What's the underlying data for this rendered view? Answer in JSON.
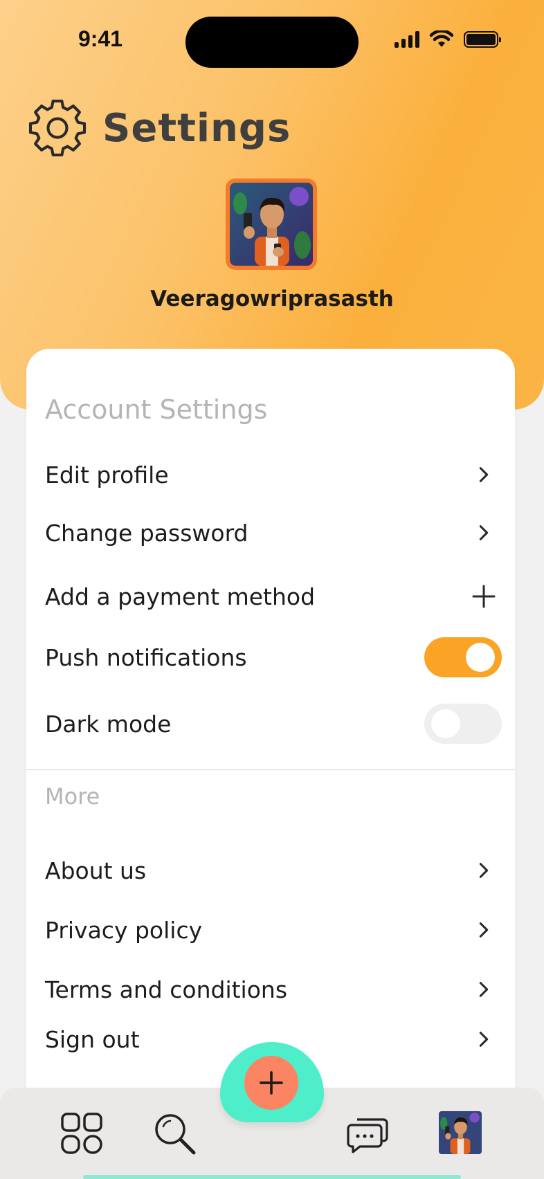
{
  "status_bar": {
    "time": "9:41"
  },
  "header": {
    "title": "Settings",
    "title_icon": "gear-icon",
    "user_name": "Veeragowriprasasth",
    "accent_color": "#fbb03d"
  },
  "account_settings": {
    "section_title": "Account Settings",
    "items": [
      {
        "label": "Edit profile",
        "control": "chevron-right-icon"
      },
      {
        "label": "Change password",
        "control": "chevron-right-icon"
      },
      {
        "label": "Add a payment method",
        "control": "plus-icon"
      },
      {
        "label": "Push notifications",
        "control": "toggle",
        "value": true
      },
      {
        "label": "Dark mode",
        "control": "toggle",
        "value": false
      }
    ]
  },
  "more": {
    "section_title": "More",
    "items": [
      {
        "label": "About us",
        "control": "chevron-right-icon"
      },
      {
        "label": "Privacy policy",
        "control": "chevron-right-icon"
      },
      {
        "label": "Terms and conditions",
        "control": "chevron-right-icon"
      },
      {
        "label": "Sign out",
        "control": "chevron-right-icon"
      }
    ]
  },
  "bottom_nav": {
    "items": [
      "grid-icon",
      "search-icon",
      "add-icon",
      "chat-icon",
      "profile-avatar"
    ],
    "fab_color": "#fb8462",
    "fab_bump_color": "#4eeecb"
  }
}
